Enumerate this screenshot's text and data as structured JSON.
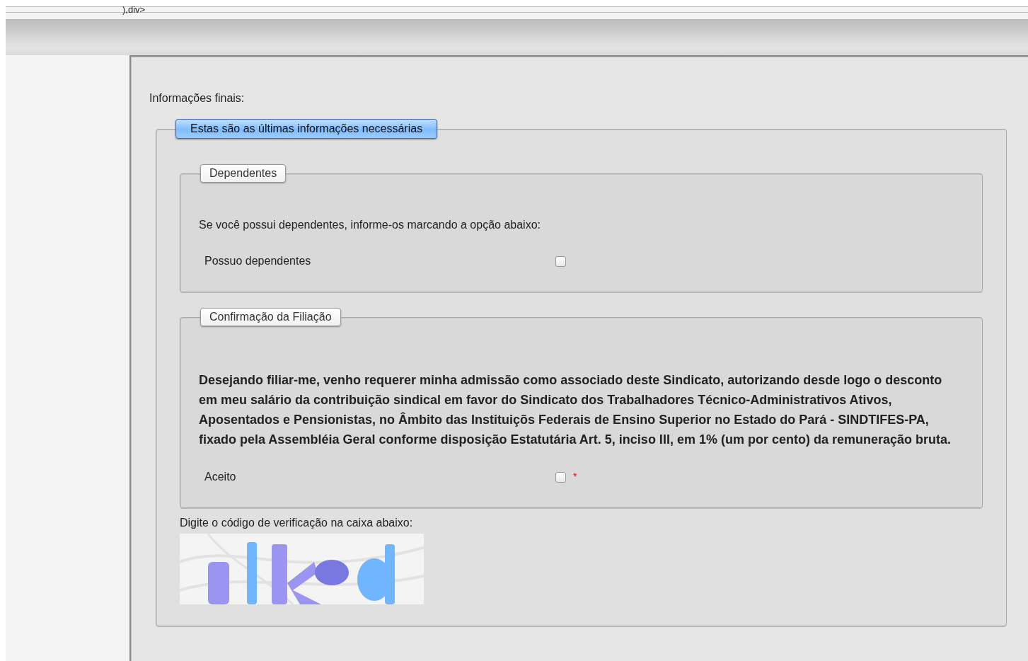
{
  "code_fragment": "),div>",
  "intro_label": "Informações finais:",
  "main_section": {
    "legend": "Estas são as últimas informações necessárias",
    "groups": [
      {
        "legend": "Dependentes",
        "description": "Se você possui dependentes, informe-os marcando a opção abaixo:",
        "emphasis": false,
        "field": {
          "label": "Possuo dependentes",
          "checked": false
        }
      },
      {
        "legend": "Confirmação da Filiação",
        "description": "Desejando filiar-me, venho requerer minha admissão como associado deste Sindicato, autorizando desde logo o desconto em meu salário da contribuição sindical em favor do Sindicato dos Trabalhadores Técnico-Administrativos Ativos, Aposentados e Pensionistas, no Âmbito das Instituiçõs Federais de Ensino Superior no Estado do Pará - SINDTIFES-PA, fixado pela Assembléia Geral conforme disposição Estatutária Art. 5, inciso III, em 1% (um por cento) da remuneração bruta.",
        "emphasis": true,
        "field": {
          "label": "Aceito",
          "checked": false,
          "required_mark": "*"
        }
      }
    ]
  },
  "captcha": {
    "instruction": "Digite o código de verificação na caixa abaixo:"
  }
}
